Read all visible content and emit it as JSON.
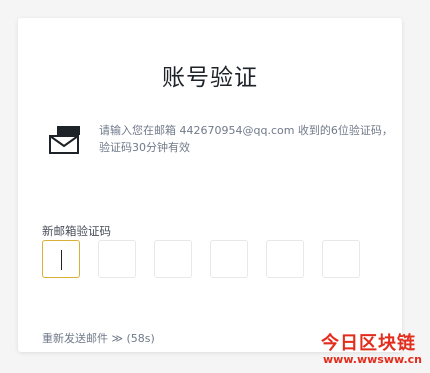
{
  "page": {
    "title": "账号验证",
    "info_text": "请输入您在邮箱 442670954@qq.com 收到的6位验证码，验证码30分钟有效",
    "field_label": "新邮箱验证码",
    "resend": {
      "label": "重新发送邮件 ≫",
      "countdown": "(58s)"
    }
  },
  "code_inputs": [
    "",
    "",
    "",
    "",
    "",
    ""
  ],
  "icons": {
    "mail": "envelope-icon"
  },
  "colors": {
    "accent": "#d9b13a",
    "text_main": "#1e2329",
    "text_muted": "#707a8a",
    "watermark": "#e22d1c"
  },
  "watermark": {
    "title": "今日区块链",
    "url": "www.wwsww.cn"
  }
}
